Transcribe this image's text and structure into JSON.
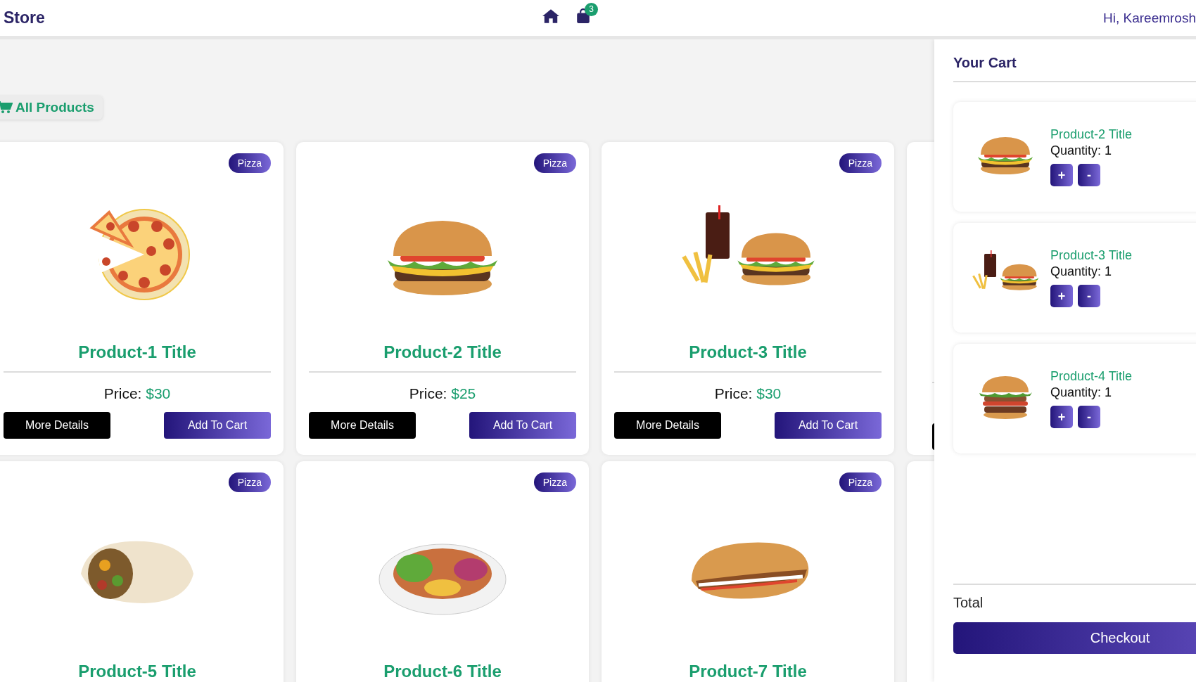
{
  "header": {
    "brand": "Store",
    "cart_count": "3",
    "greeting": "Hi, Kareemrosh"
  },
  "filter": {
    "label": "All Products"
  },
  "products": [
    {
      "title": "Product-1 Title",
      "category": "Pizza",
      "kind": "pizza",
      "price_label": "Price:",
      "price": "$30",
      "buttons": [
        "More Details",
        "Add To Cart"
      ]
    },
    {
      "title": "Product-2 Title",
      "category": "Pizza",
      "kind": "burger",
      "price_label": "Price:",
      "price": "$25",
      "buttons": [
        "More Details",
        "Add To Cart"
      ]
    },
    {
      "title": "Product-3 Title",
      "category": "Pizza",
      "kind": "combo",
      "price_label": "Price:",
      "price": "$30",
      "buttons": [
        "More Details",
        "Add To Cart"
      ]
    },
    {
      "title": "Product-5 Title",
      "category": "Pizza",
      "kind": "wrap"
    },
    {
      "title": "Product-6 Title",
      "category": "Pizza",
      "kind": "plate"
    },
    {
      "title": "Product-7 Title",
      "category": "Pizza",
      "kind": "sandwich"
    }
  ],
  "cart": {
    "title": "Your Cart",
    "items": [
      {
        "title": "Product-2 Title",
        "quantity": "Quantity: 1",
        "kind": "burger",
        "plus": "+",
        "minus": "-"
      },
      {
        "title": "Product-3 Title",
        "quantity": "Quantity: 1",
        "kind": "combo",
        "plus": "+",
        "minus": "-"
      },
      {
        "title": "Product-4 Title",
        "quantity": "Quantity: 1",
        "kind": "tallburger",
        "plus": "+",
        "minus": "-"
      }
    ],
    "total_label": "Total",
    "checkout": "Checkout"
  }
}
